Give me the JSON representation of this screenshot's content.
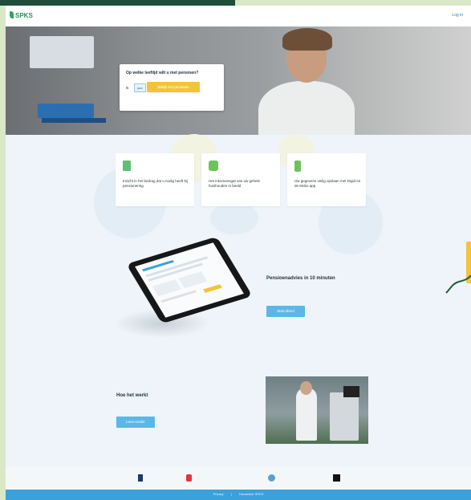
{
  "header": {
    "logo_text": "SPKS",
    "login_text": "Log in"
  },
  "hero": {
    "intro_text": "",
    "question": "Op welke leeftijd wilt u met pensioen?",
    "option_label": "Ik",
    "option_value": "jaar",
    "cta_label": "Bekijk het pensioen",
    "small_text": ""
  },
  "features": [
    {
      "icon": "document-chart-icon",
      "text": "Inzicht in het bedrag dat u nodig heeft bij pensionering"
    },
    {
      "icon": "people-icon",
      "text": "Het inkomensgat van uw gehele huishouden in beeld"
    },
    {
      "icon": "phone-icon",
      "text": "Uw gegevens veilig opslaan met Digid en de Mobo app"
    }
  ],
  "preview": {
    "title": "Pensioenadvies in 10 minuten",
    "description": "",
    "button_label": "Start direct"
  },
  "how": {
    "title": "Hoe het werkt",
    "description": "",
    "button_label": "Lees verder"
  },
  "partners": [
    {
      "name": "",
      "icon": "partner-logo-1-icon",
      "color": "#1c3a6b"
    },
    {
      "name": "",
      "icon": "partner-logo-2-icon",
      "color": "#e2333b"
    },
    {
      "name": "",
      "icon": "partner-logo-3-icon",
      "color": "#5a9fd6"
    },
    {
      "name": "",
      "icon": "partner-logo-4-icon",
      "color": "#111111"
    }
  ],
  "footer": {
    "links": [
      "Privacy",
      "|",
      "Disclaimer SPKS"
    ]
  },
  "colors": {
    "brand_green": "#2fa35a",
    "accent_yellow": "#f5c33b",
    "accent_blue": "#5bb8e6",
    "footer_blue": "#3aa1db"
  }
}
